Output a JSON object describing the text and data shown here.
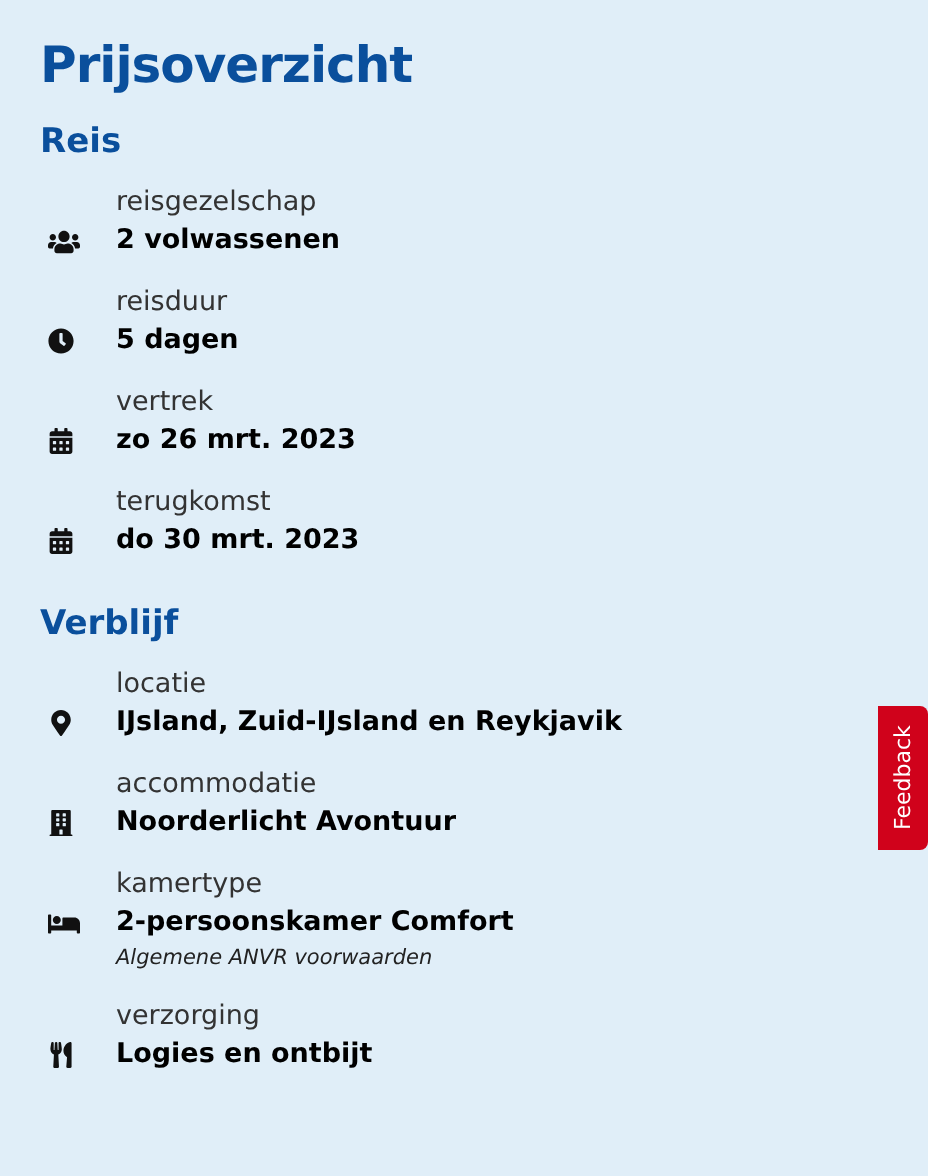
{
  "title": "Prijsoverzicht",
  "sections": [
    {
      "heading": "Reis",
      "items": [
        {
          "kind": "group",
          "label": "reisgezelschap",
          "value": "2 volwassenen"
        },
        {
          "kind": "duration",
          "label": "reisduur",
          "value": "5 dagen"
        },
        {
          "kind": "date",
          "label": "vertrek",
          "value": "zo 26 mrt. 2023"
        },
        {
          "kind": "date",
          "label": "terugkomst",
          "value": "do 30 mrt. 2023"
        }
      ]
    },
    {
      "heading": "Verblijf",
      "items": [
        {
          "kind": "location",
          "label": "locatie",
          "value": "IJsland, Zuid-IJsland en Reykjavik"
        },
        {
          "kind": "accommodation",
          "label": "accommodatie",
          "value": "Noorderlicht Avontuur"
        },
        {
          "kind": "room",
          "label": "kamertype",
          "value": "2-persoonskamer Comfort",
          "note": "Algemene ANVR voorwaarden"
        },
        {
          "kind": "meals",
          "label": "verzorging",
          "value": "Logies en ontbijt"
        }
      ]
    }
  ],
  "feedback": "Feedback"
}
